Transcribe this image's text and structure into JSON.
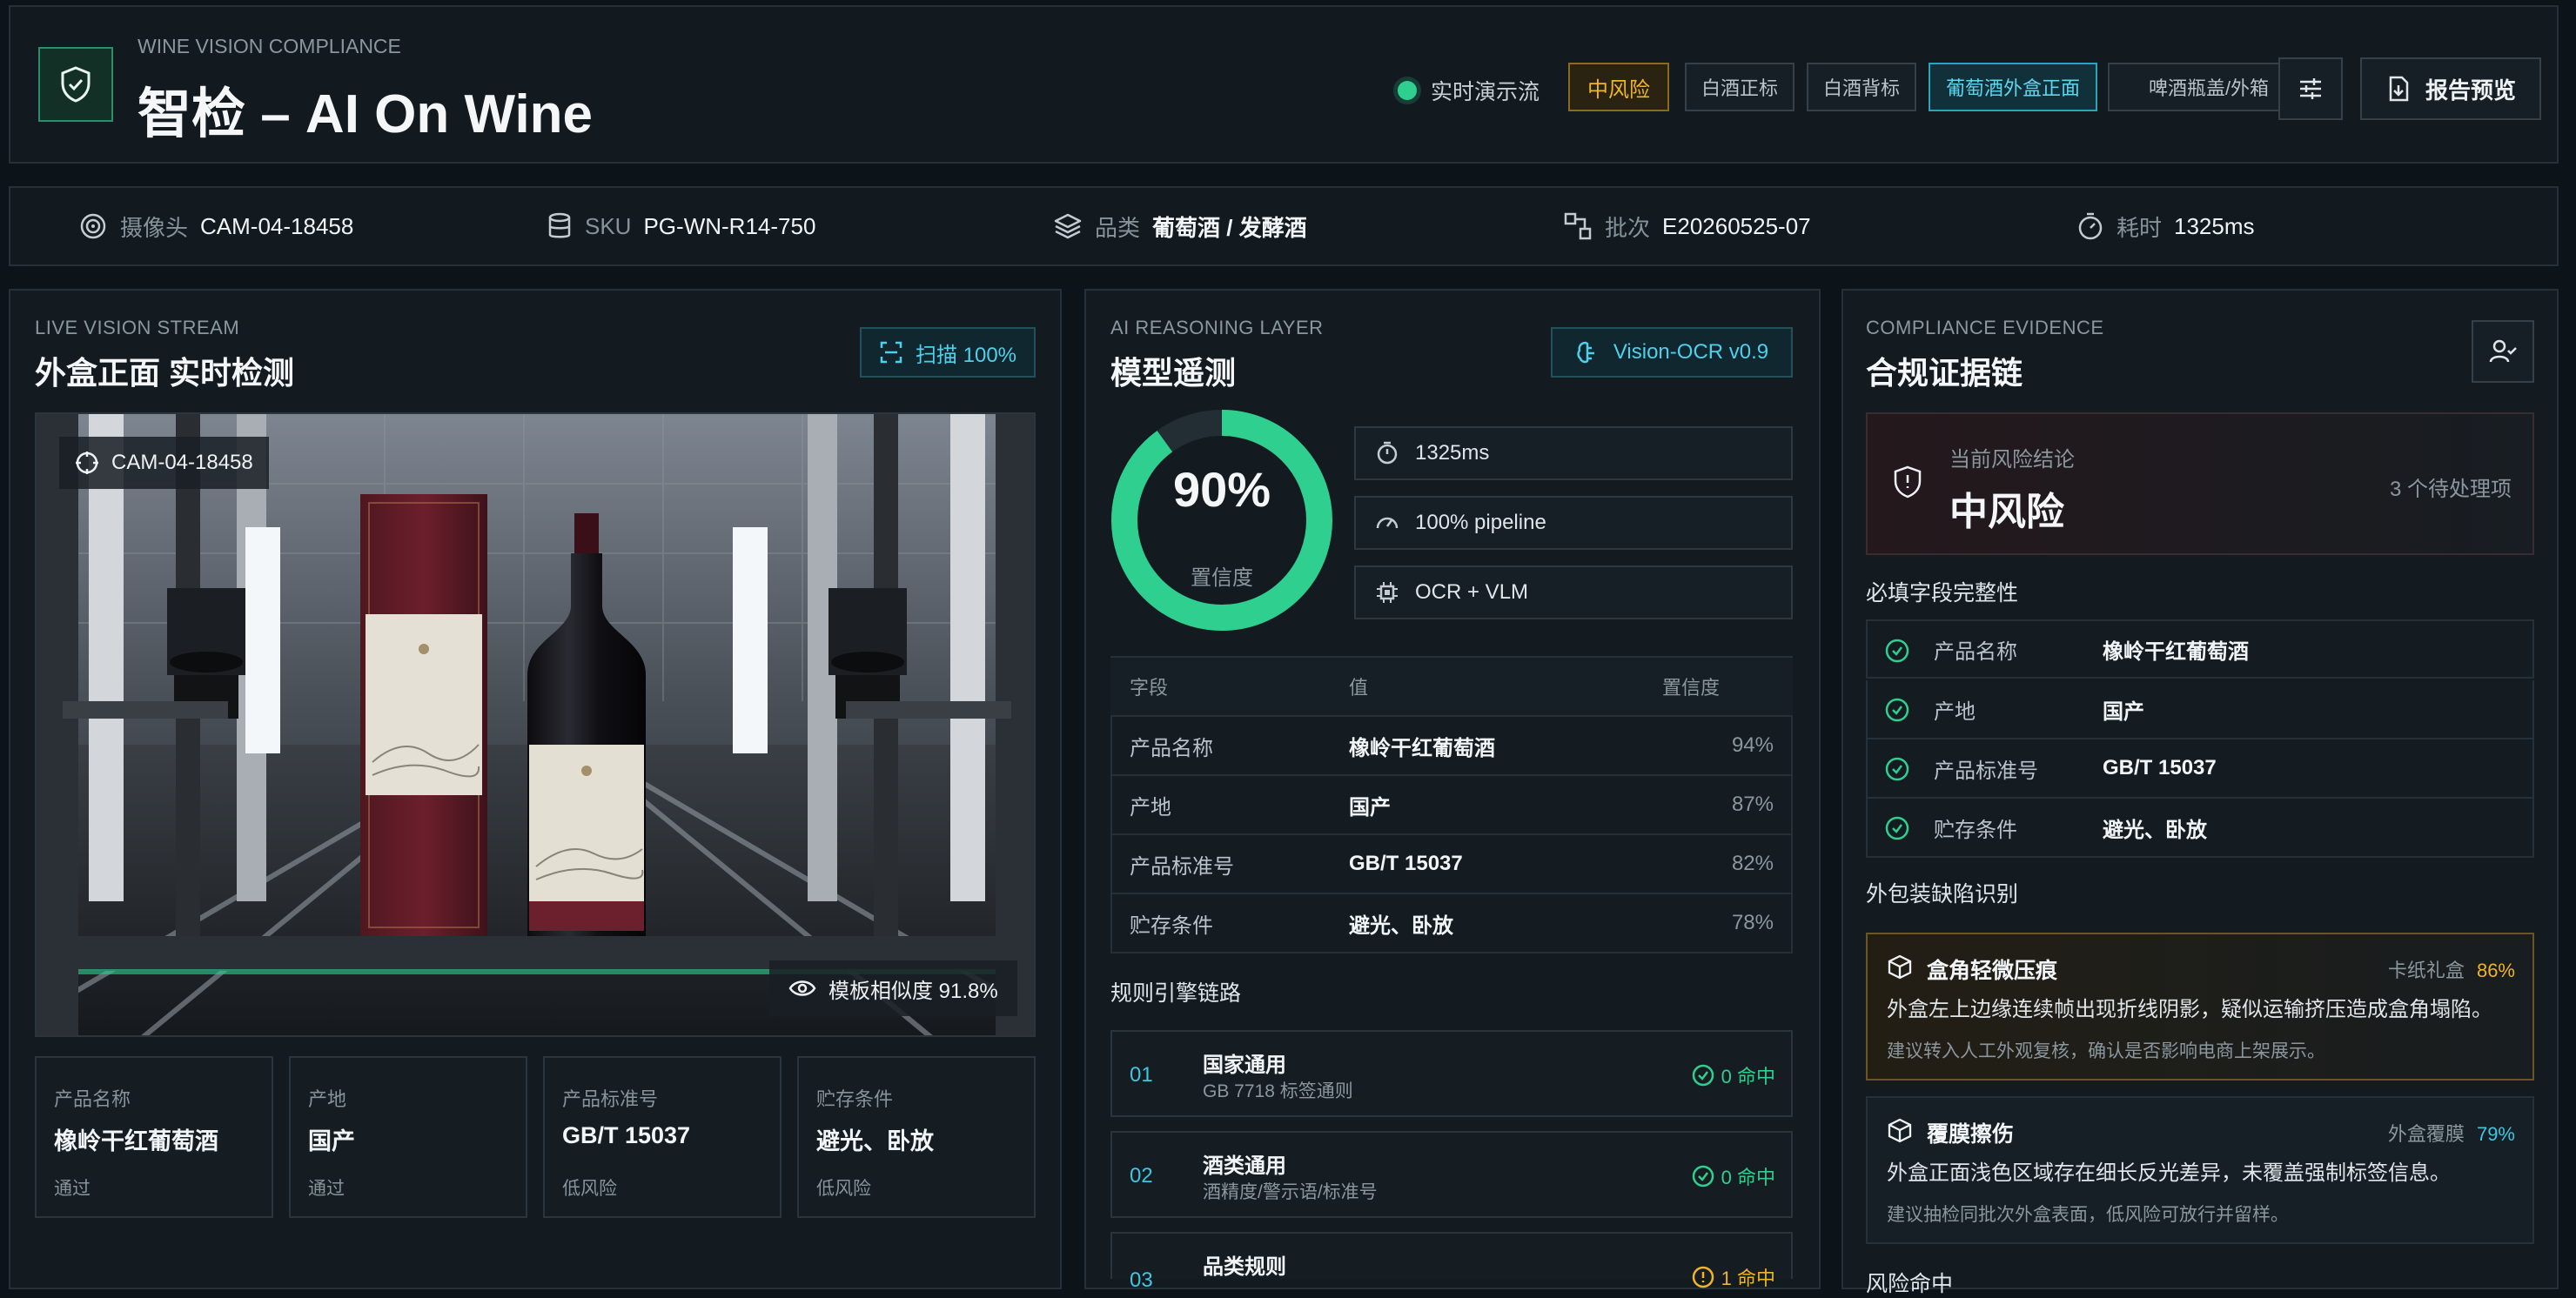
{
  "header": {
    "eyebrow": "WINE VISION COMPLIANCE",
    "title": "智检 – AI On Wine",
    "live_label": "实时演示流",
    "risk_badge": "中风险",
    "chips": [
      "白酒正标",
      "白酒背标",
      "葡萄酒外盒正面",
      "啤酒瓶盖/外箱"
    ],
    "report_button": "报告预览"
  },
  "infobar": {
    "camera": {
      "label": "摄像头",
      "value": "CAM-04-18458"
    },
    "sku": {
      "label": "SKU",
      "value": "PG-WN-R14-750"
    },
    "category": {
      "label": "品类",
      "value": "葡萄酒 / 发酵酒"
    },
    "batch": {
      "label": "批次",
      "value": "E20260525-07"
    },
    "time": {
      "label": "耗时",
      "value": "1325ms"
    }
  },
  "stream": {
    "eyebrow": "LIVE VISION STREAM",
    "title": "外盒正面 实时检测",
    "scan_badge": "扫描 100%",
    "cam_tag": "CAM-04-18458",
    "similarity": "模板相似度 91.8%",
    "fields": [
      {
        "label": "产品名称",
        "value": "橡岭干红葡萄酒",
        "status": "通过"
      },
      {
        "label": "产地",
        "value": "国产",
        "status": "通过"
      },
      {
        "label": "产品标准号",
        "value": "GB/T 15037",
        "status": "低风险"
      },
      {
        "label": "贮存条件",
        "value": "避光、卧放",
        "status": "低风险"
      }
    ]
  },
  "reasoning": {
    "eyebrow": "AI REASONING LAYER",
    "title": "模型遥测",
    "model_badge": "Vision-OCR v0.9",
    "confidence_text": "90%",
    "confidence_value": 0.9,
    "confidence_label": "置信度",
    "stats": [
      "1325ms",
      "100% pipeline",
      "OCR + VLM"
    ],
    "table_headers": [
      "字段",
      "值",
      "置信度"
    ],
    "table_rows": [
      {
        "field": "产品名称",
        "value": "橡岭干红葡萄酒",
        "conf": "94%"
      },
      {
        "field": "产地",
        "value": "国产",
        "conf": "87%"
      },
      {
        "field": "产品标准号",
        "value": "GB/T 15037",
        "conf": "82%"
      },
      {
        "field": "贮存条件",
        "value": "避光、卧放",
        "conf": "78%"
      }
    ],
    "rules_title": "规则引擎链路",
    "rules": [
      {
        "num": "01",
        "title": "国家通用",
        "sub": "GB 7718 标签通则",
        "hit": "0 命中"
      },
      {
        "num": "02",
        "title": "酒类通用",
        "sub": "酒精度/警示语/标准号",
        "hit": "0 命中"
      },
      {
        "num": "03",
        "title": "品类规则",
        "sub": "",
        "hit": "1 命中"
      }
    ]
  },
  "evidence": {
    "eyebrow": "COMPLIANCE EVIDENCE",
    "title": "合规证据链",
    "risk_label": "当前风险结论",
    "risk_value": "中风险",
    "pending": "3 个待处理项",
    "required_title": "必填字段完整性",
    "required": [
      {
        "label": "产品名称",
        "value": "橡岭干红葡萄酒"
      },
      {
        "label": "产地",
        "value": "国产"
      },
      {
        "label": "产品标准号",
        "value": "GB/T 15037"
      },
      {
        "label": "贮存条件",
        "value": "避光、卧放"
      }
    ],
    "defects_title": "外包装缺陷识别",
    "defects": [
      {
        "title": "盒角轻微压痕",
        "tag": "卡纸礼盒",
        "pct": "86%",
        "desc": "外盒左上边缘连续帧出现折线阴影，疑似运输挤压造成盒角塌陷。",
        "sugg": "建议转入人工外观复核，确认是否影响电商上架展示。"
      },
      {
        "title": "覆膜擦伤",
        "tag": "外盒覆膜",
        "pct": "79%",
        "desc": "外盒正面浅色区域存在细长反光差异，未覆盖强制标签信息。",
        "sugg": "建议抽检同批次外盒表面，低风险可放行并留样。"
      }
    ],
    "next_title": "风险命中"
  },
  "colors": {
    "accent": "#2fd08f",
    "cyan": "#3ec7e0",
    "amber": "#f0b429",
    "bg": "#0d1419"
  }
}
